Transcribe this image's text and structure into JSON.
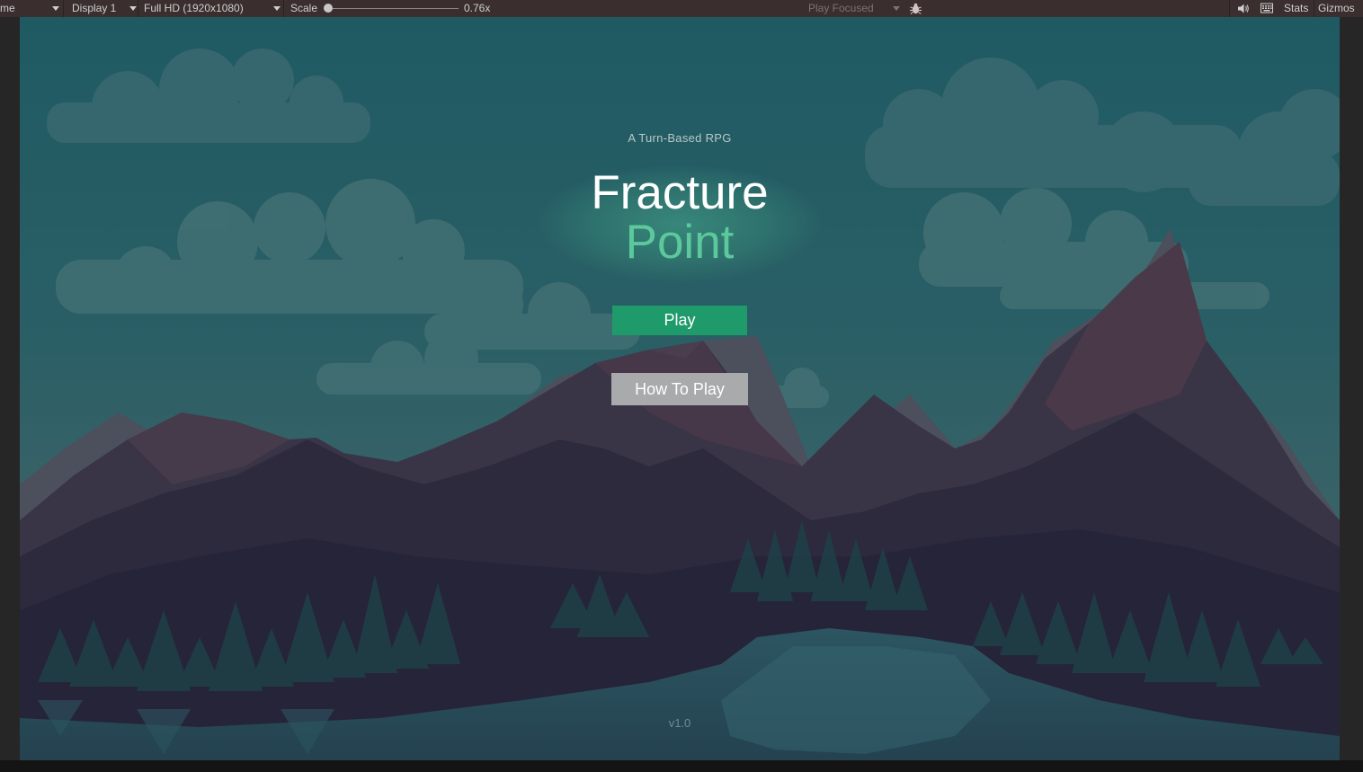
{
  "editor": {
    "view_label": "me",
    "display": "Display 1",
    "resolution": "Full HD (1920x1080)",
    "scale_label": "Scale",
    "scale_value": "0.76x",
    "play_mode": "Play Focused",
    "stats": "Stats",
    "gizmos": "Gizmos",
    "icons": [
      "bug-icon",
      "audio-icon",
      "keyboard-icon"
    ]
  },
  "game": {
    "subtitle": "A Turn-Based RPG",
    "title_line1": "Fracture",
    "title_line2": "Point",
    "play_label": "Play",
    "how_to_play_label": "How To Play",
    "version": "v1.0"
  },
  "colors": {
    "title_accent": "#5bc99b",
    "play_button": "#1e9a6b",
    "secondary_button": "#a9aaab",
    "toolbar_bg": "#3a2f2e"
  }
}
